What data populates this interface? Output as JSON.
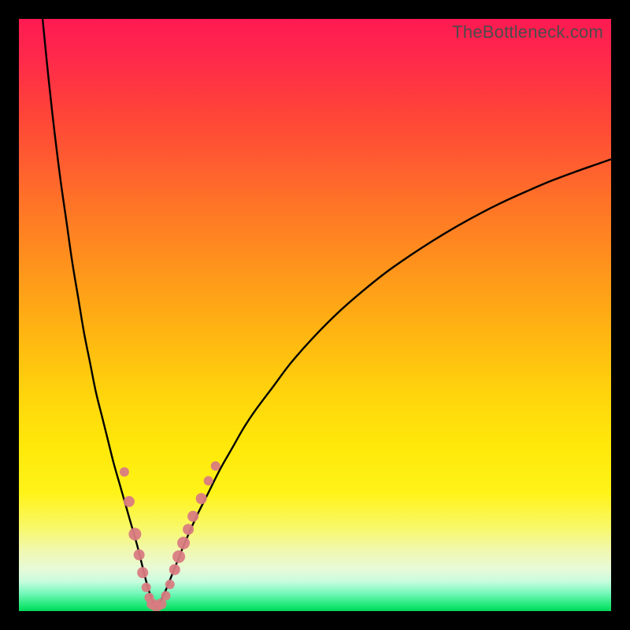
{
  "watermark": "TheBottleneck.com",
  "colors": {
    "frame": "#000000",
    "gradient_top": "#ff1a52",
    "gradient_mid": "#ffd60c",
    "gradient_bottom": "#00d85a",
    "curve": "#000000",
    "marker": "#d97b81"
  },
  "chart_data": {
    "type": "line",
    "title": "",
    "xlabel": "",
    "ylabel": "",
    "xlim": [
      0,
      100
    ],
    "ylim": [
      0,
      100
    ],
    "grid": false,
    "series": [
      {
        "name": "left-curve",
        "x": [
          4,
          5,
          6,
          7,
          8,
          9,
          10,
          11,
          12,
          13,
          14,
          15,
          16,
          17,
          18,
          19,
          20,
          20.5,
          21,
          21.5,
          22,
          22.5,
          23
        ],
        "y": [
          100,
          90,
          81,
          73,
          66,
          59,
          53,
          47,
          42,
          37,
          33,
          29,
          25,
          21.5,
          18,
          14.5,
          11,
          9,
          7,
          5,
          3.3,
          1.8,
          0.6
        ]
      },
      {
        "name": "right-curve",
        "x": [
          23,
          24,
          25,
          26,
          27,
          28,
          30,
          32,
          34,
          36,
          38,
          40,
          43,
          46,
          50,
          54,
          58,
          62,
          66,
          70,
          74,
          78,
          82,
          86,
          90,
          94,
          98,
          100
        ],
        "y": [
          0.6,
          1.8,
          4,
          6.5,
          9,
          11.5,
          16,
          20,
          24,
          27.5,
          31,
          34,
          38,
          42,
          46.5,
          50.5,
          54,
          57.2,
          60,
          62.6,
          65,
          67.2,
          69.2,
          71,
          72.7,
          74.2,
          75.6,
          76.3
        ]
      }
    ],
    "markers": [
      {
        "x": 17.8,
        "y": 23.5,
        "r": 6
      },
      {
        "x": 18.6,
        "y": 18.5,
        "r": 7
      },
      {
        "x": 19.6,
        "y": 13.0,
        "r": 8
      },
      {
        "x": 20.3,
        "y": 9.5,
        "r": 7
      },
      {
        "x": 20.9,
        "y": 6.5,
        "r": 7
      },
      {
        "x": 21.5,
        "y": 4.0,
        "r": 6
      },
      {
        "x": 22.0,
        "y": 2.3,
        "r": 6
      },
      {
        "x": 22.5,
        "y": 1.2,
        "r": 7
      },
      {
        "x": 23.2,
        "y": 0.8,
        "r": 7
      },
      {
        "x": 24.0,
        "y": 1.2,
        "r": 7
      },
      {
        "x": 24.8,
        "y": 2.6,
        "r": 6
      },
      {
        "x": 25.5,
        "y": 4.5,
        "r": 6
      },
      {
        "x": 26.3,
        "y": 7.0,
        "r": 7
      },
      {
        "x": 27.0,
        "y": 9.2,
        "r": 8
      },
      {
        "x": 27.8,
        "y": 11.5,
        "r": 8
      },
      {
        "x": 28.6,
        "y": 13.8,
        "r": 7
      },
      {
        "x": 29.4,
        "y": 16.0,
        "r": 7
      },
      {
        "x": 30.8,
        "y": 19.0,
        "r": 7
      },
      {
        "x": 32.0,
        "y": 22.0,
        "r": 6
      },
      {
        "x": 33.2,
        "y": 24.5,
        "r": 6
      }
    ]
  }
}
